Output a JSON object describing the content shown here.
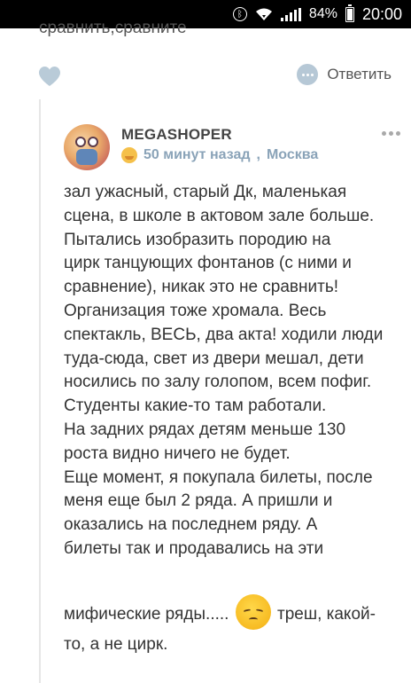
{
  "status_bar": {
    "battery_percent": "84%",
    "time": "20:00",
    "icons": [
      "bluetooth-icon",
      "wifi-icon",
      "signal-icon",
      "battery-icon"
    ]
  },
  "previous_comment": {
    "tail_text": "сравнить,сравните",
    "actions": {
      "like_icon": "heart-icon",
      "reply_label": "Ответить"
    }
  },
  "comment": {
    "author": "MEGASHOPER",
    "time_ago": "50 минут назад",
    "city": "Москва",
    "body_lines": [
      "зал ужасный, старый Дк, маленькая",
      "сцена, в школе в актовом зале больше.",
      "Пытались изобразить породию на",
      "цирк танцующих фонтанов (с ними и",
      "сравнение), никак это не сравнить!",
      "Организация тоже хромала. Весь",
      "спектакль, ВЕСЬ, два акта! ходили люди",
      "туда-сюда, свет из двери мешал, дети",
      "носились по залу голопом, всем пофиг.",
      "Студенты какие-то там работали.",
      "На задних рядах детям меньше 130",
      "роста видно ничего не будет.",
      "Еще момент, я покупала билеты, после",
      "меня еще был 2 ряда. А пришли и",
      "оказались на последнем ряду. А",
      "билеты так и продавались на эти"
    ],
    "last_line_before": "мифические ряды.....",
    "last_line_after": "треш, какой-",
    "final_line": "то, а не цирк.",
    "emoji_name": "disappointed-face-emoji"
  }
}
